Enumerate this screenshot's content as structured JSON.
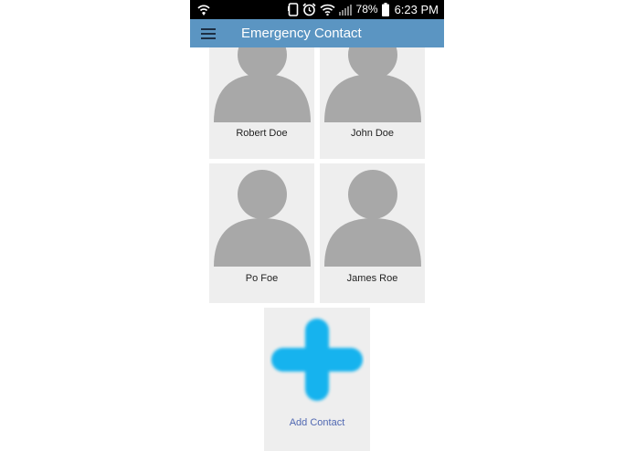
{
  "status_bar": {
    "battery": "78%",
    "time": "6:23 PM",
    "icons": [
      "wifi-calling-icon",
      "phone-outline-icon",
      "alarm-icon",
      "wifi-icon",
      "signal-icon",
      "battery-icon"
    ]
  },
  "app_bar": {
    "title": "Emergency Contact",
    "menu_icon": "hamburger-menu-icon",
    "color": "#5b95c2"
  },
  "contacts": [
    {
      "name": "Robert Doe",
      "avatar": "person-placeholder-icon"
    },
    {
      "name": "John Doe",
      "avatar": "person-placeholder-icon"
    },
    {
      "name": "Po Foe",
      "avatar": "person-placeholder-icon"
    },
    {
      "name": "James Roe",
      "avatar": "person-placeholder-icon"
    }
  ],
  "add_contact": {
    "label": "Add Contact",
    "icon": "plus-icon",
    "color": "#12b3ee"
  }
}
